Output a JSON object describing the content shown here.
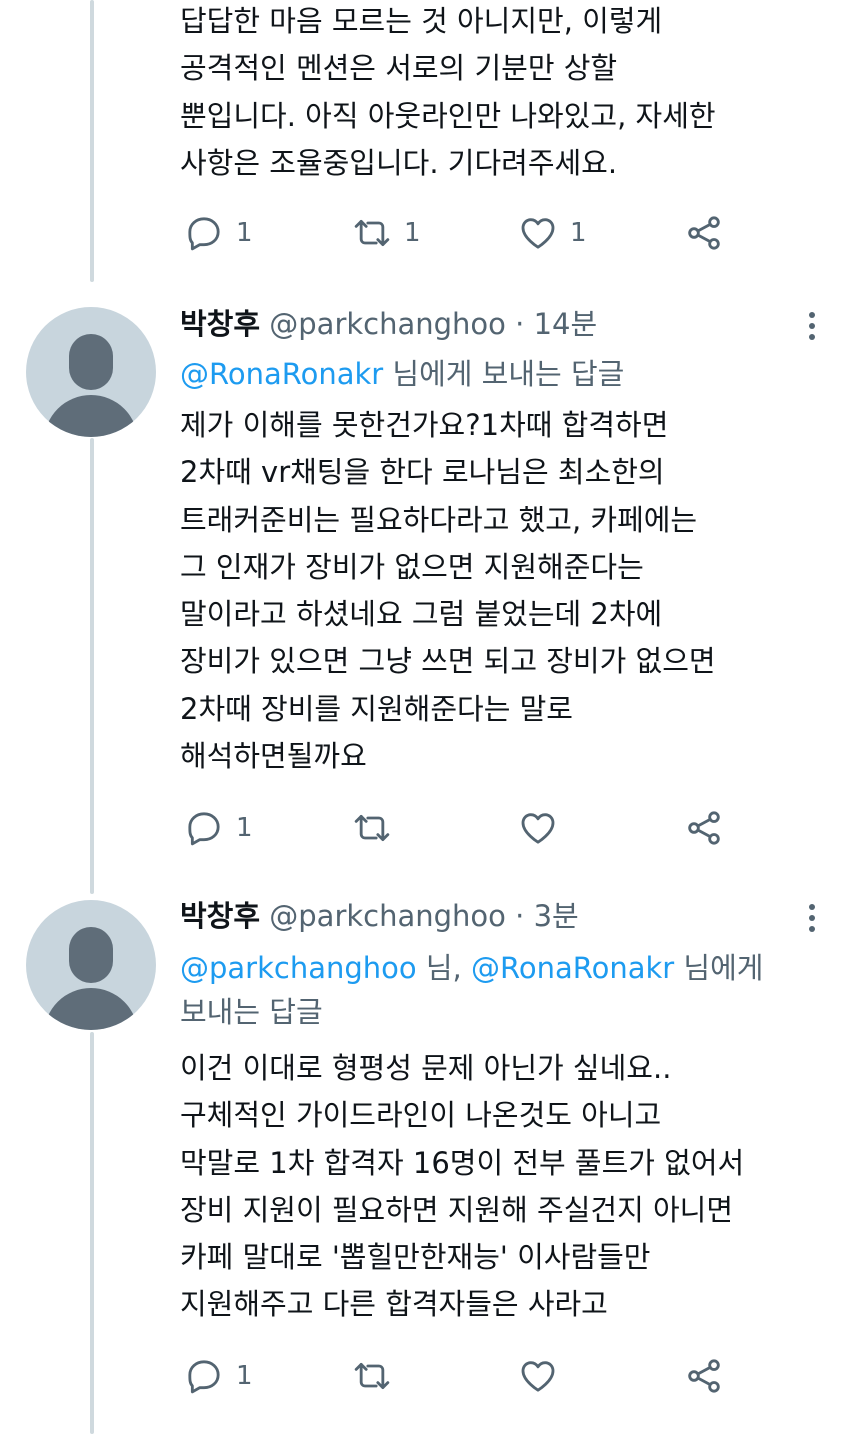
{
  "tweets": [
    {
      "body_lines": [
        "답답한 마음 모르는 것 아니지만, 이렇게",
        "공격적인 멘션은 서로의 기분만 상할",
        "뿐입니다. 아직 아웃라인만 나와있고, 자세한",
        "사항은 조율중입니다. 기다려주세요."
      ],
      "reply_count": "1",
      "retweet_count": "1",
      "like_count": "1"
    },
    {
      "name": "박창후",
      "handle": "@parkchanghoo",
      "dot": "·",
      "time": "14분",
      "replying_mention": "@RonaRonakr",
      "replying_suffix": " 님에게 보내는 답글",
      "body_lines": [
        "제가 이해를 못한건가요?1차때 합격하면",
        "2차때 vr채팅을 한다 로나님은 최소한의",
        "트래커준비는 필요하다라고 했고, 카페에는",
        "그 인재가 장비가 없으면 지원해준다는",
        "말이라고 하셨네요 그럼 붙었는데 2차에",
        "장비가 있으면 그냥 쓰면 되고 장비가 없으면",
        "2차때 장비를 지원해준다는 말로",
        "해석하면될까요"
      ],
      "reply_count": "1",
      "retweet_count": "",
      "like_count": ""
    },
    {
      "name": "박창후",
      "handle": "@parkchanghoo",
      "dot": "·",
      "time": "3분",
      "replying_mention_1": "@parkchanghoo",
      "replying_sep": " 님, ",
      "replying_mention_2": "@RonaRonakr",
      "replying_suffix_1": " 님에게",
      "replying_suffix_2": "보내는 답글",
      "body_lines": [
        "이건 이대로 형평성 문제 아닌가 싶네요..",
        "구체적인 가이드라인이 나온것도 아니고",
        "막말로 1차 합격자 16명이 전부 풀트가 없어서",
        "장비 지원이 필요하면 지원해 주실건지 아니면",
        "카페 말대로 '뽑힐만한재능' 이사람들만",
        "지원해주고 다른 합격자들은 사라고"
      ],
      "reply_count": "1",
      "retweet_count": "",
      "like_count": ""
    }
  ],
  "colors": {
    "text": "#0f1419",
    "secondary": "#536471",
    "link": "#1d9bf0",
    "thread_line": "#cfd9de",
    "avatar_bg": "#c8d5dd",
    "avatar_fg": "#5f6d79"
  },
  "icons": [
    "reply-icon",
    "retweet-icon",
    "like-icon",
    "share-icon",
    "more-icon"
  ]
}
